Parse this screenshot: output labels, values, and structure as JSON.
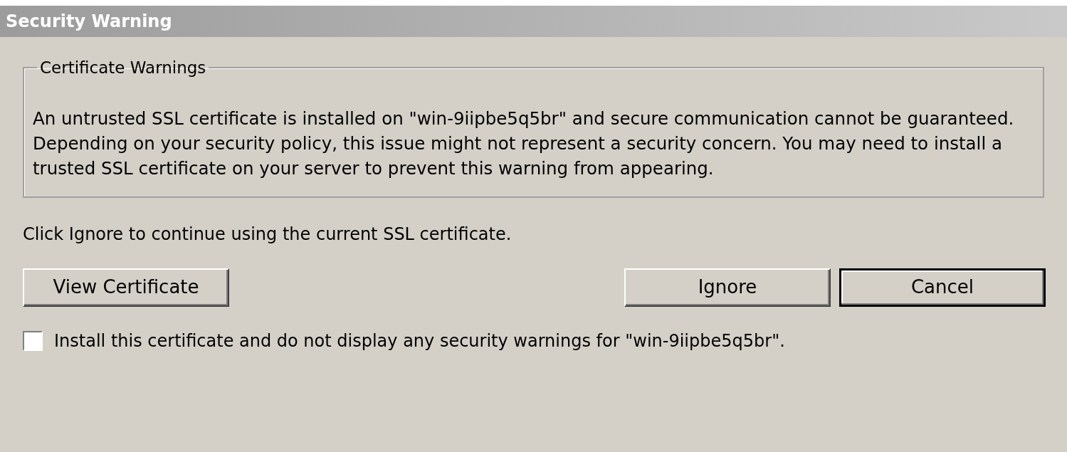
{
  "window": {
    "title": "Security Warning"
  },
  "group": {
    "legend": "Certificate Warnings",
    "message": "An untrusted SSL certificate is installed on \"win-9iipbe5q5br\" and secure communication cannot be guaranteed.  Depending on your security policy, this issue might not represent a security concern.  You may need to install a trusted SSL certificate on your server to prevent this warning from appearing."
  },
  "instruction": "Click Ignore to continue using the current SSL certificate.",
  "buttons": [
    {
      "label": "View Certificate",
      "default": false
    },
    {
      "label": "Ignore",
      "default": false
    },
    {
      "label": "Cancel",
      "default": true
    }
  ],
  "checkbox": {
    "label": "Install this certificate and do not display any security warnings for \"win-9iipbe5q5br\".",
    "checked": false
  }
}
